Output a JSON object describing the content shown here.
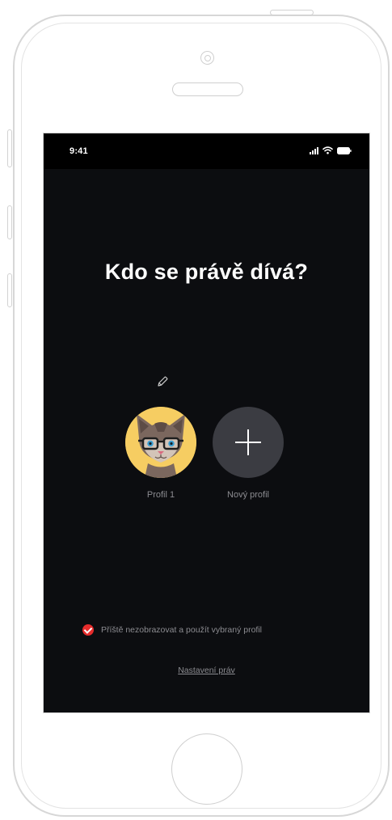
{
  "status_bar": {
    "time": "9:41"
  },
  "screen": {
    "title": "Kdo se právě dívá?",
    "profiles": [
      {
        "label": "Profil 1",
        "avatar": "cat-with-glasses-avatar"
      },
      {
        "label": "Nový profil",
        "icon": "plus-icon"
      }
    ],
    "checkbox": {
      "label": "Příště nezobrazovat a použít vybraný profil",
      "checked": true
    },
    "settings_link": "Nastavení práv"
  },
  "colors": {
    "screen_background": "#0c0d10",
    "avatar_background": "#f6cd62",
    "add_profile_background": "#3b3c42",
    "accent": "#e62c2c"
  },
  "icons": {
    "edit": "pencil-icon",
    "signal": "signal-icon",
    "wifi": "wifi-icon",
    "battery": "battery-icon"
  }
}
